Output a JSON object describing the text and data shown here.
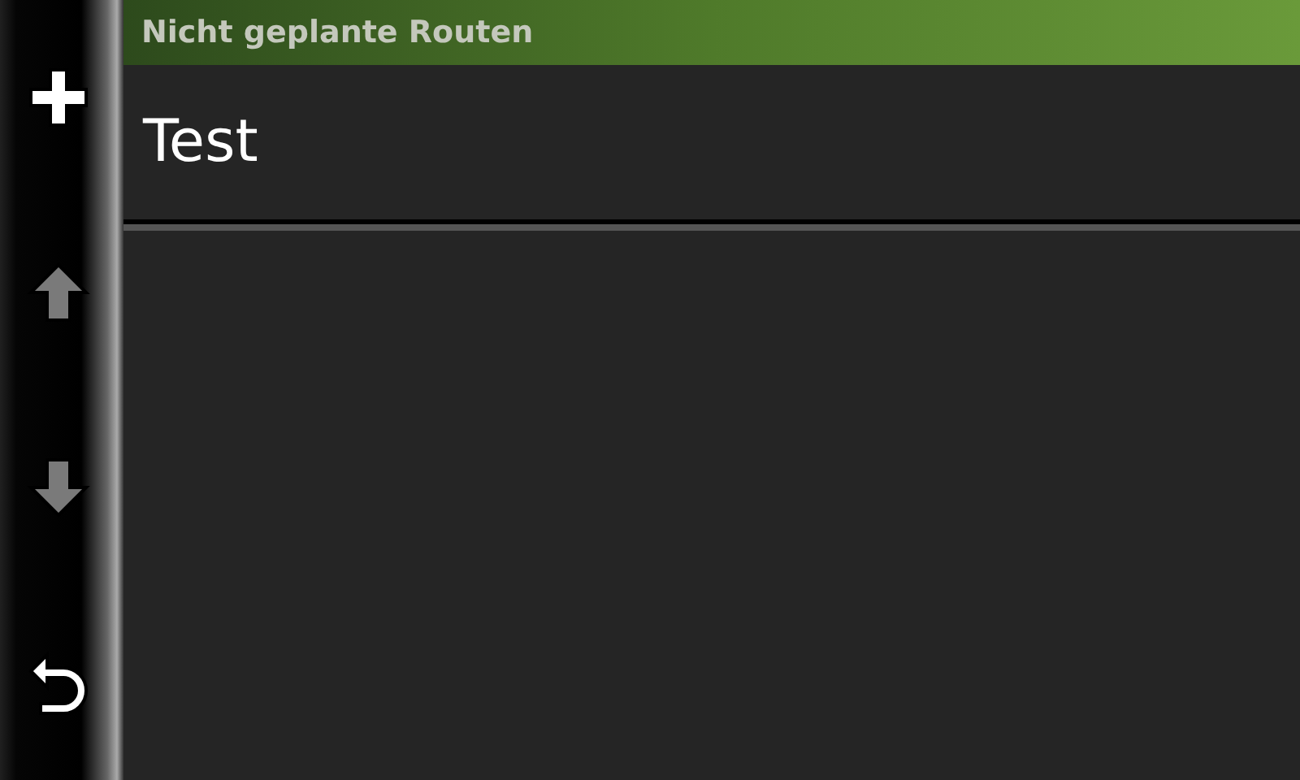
{
  "header": {
    "title": "Nicht geplante Routen"
  },
  "toolbar": [
    {
      "kind": "add",
      "disabled": false
    },
    {
      "kind": "up",
      "disabled": true
    },
    {
      "kind": "down",
      "disabled": true
    },
    {
      "kind": "back",
      "disabled": false
    }
  ],
  "routes": [
    {
      "label": "Test"
    }
  ]
}
